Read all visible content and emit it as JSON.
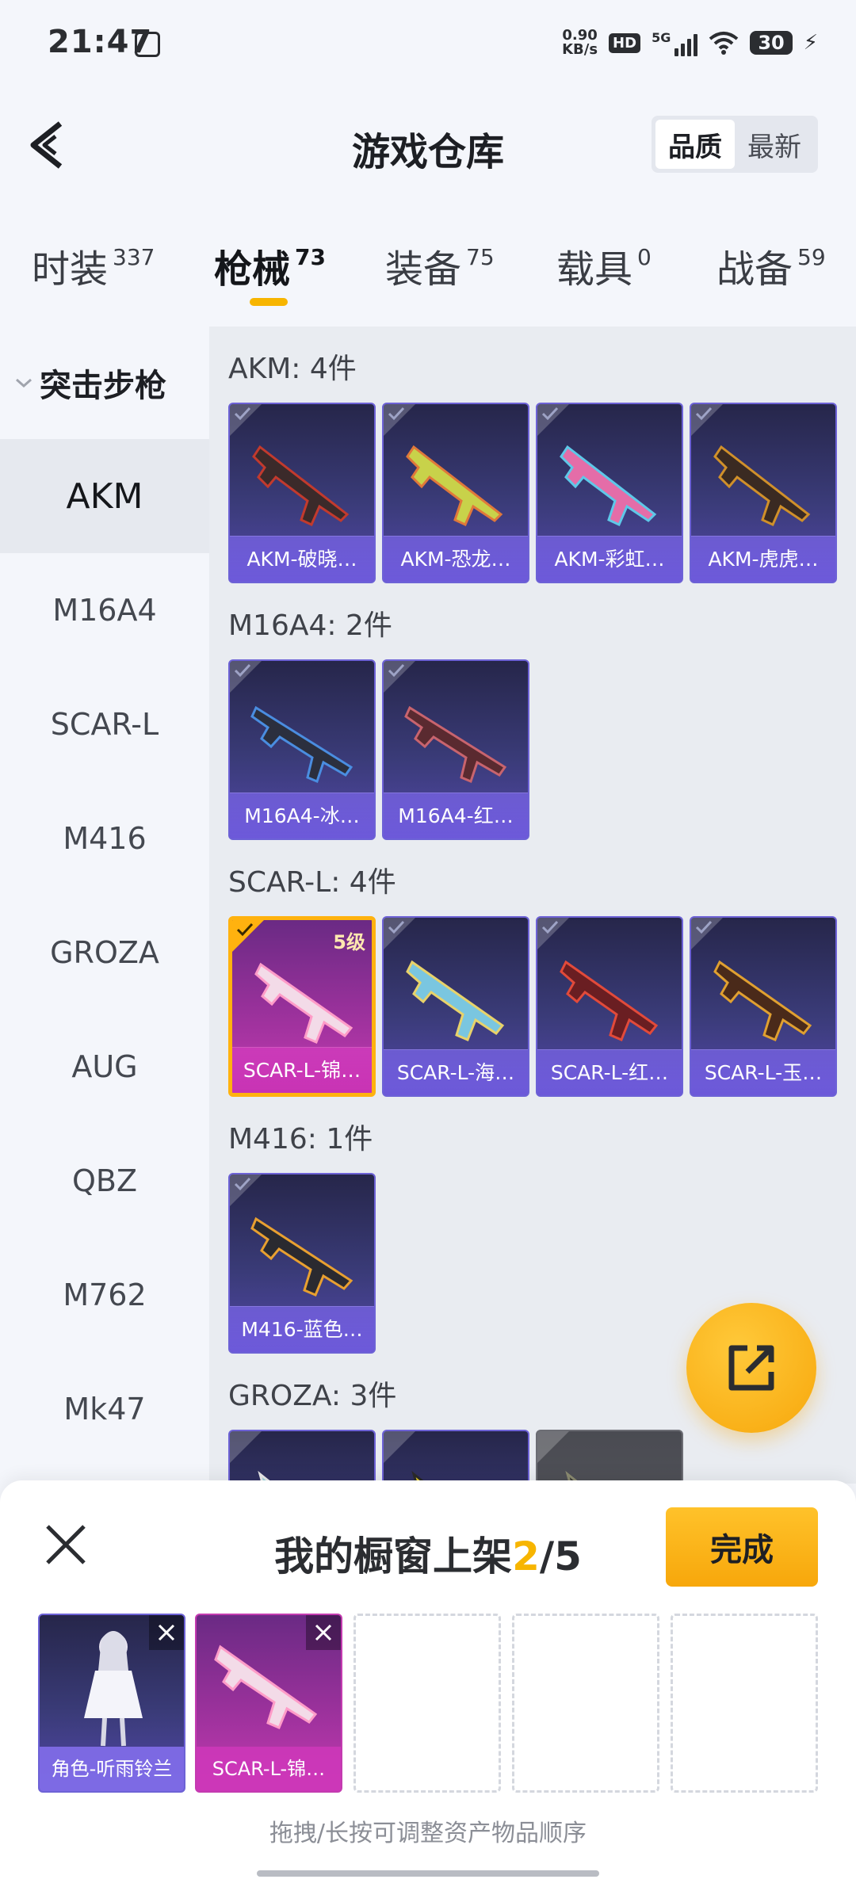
{
  "status_bar": {
    "time": "21:47",
    "net_speed_value": "0.90",
    "net_speed_unit": "KB/s",
    "hd": "HD",
    "network": "5G",
    "battery": "30"
  },
  "header": {
    "title": "游戏仓库",
    "sort_quality": "品质",
    "sort_latest": "最新"
  },
  "tabs": [
    {
      "label": "时装",
      "count": "337"
    },
    {
      "label": "枪械",
      "count": "73"
    },
    {
      "label": "装备",
      "count": "75"
    },
    {
      "label": "载具",
      "count": "0"
    },
    {
      "label": "战备",
      "count": "59"
    }
  ],
  "sidebar": {
    "group": "突击步枪",
    "items": [
      "AKM",
      "M16A4",
      "SCAR-L",
      "M416",
      "GROZA",
      "AUG",
      "QBZ",
      "M762",
      "Mk47"
    ]
  },
  "sections": [
    {
      "label": "AKM: 4件",
      "items": [
        "AKM-破晓…",
        "AKM-恐龙…",
        "AKM-彩虹…",
        "AKM-虎虎…"
      ]
    },
    {
      "label": "M16A4: 2件",
      "items": [
        "M16A4-冰…",
        "M16A4-红…"
      ]
    },
    {
      "label": "SCAR-L: 4件",
      "items": [
        "SCAR-L-锦…",
        "SCAR-L-海…",
        "SCAR-L-红…",
        "SCAR-L-玉…"
      ],
      "selected_level": "5级"
    },
    {
      "label": "M416: 1件",
      "items": [
        "M416-蓝色…"
      ]
    },
    {
      "label": "GROZA: 3件",
      "items": [
        "",
        "",
        ""
      ]
    }
  ],
  "sheet": {
    "title_prefix": "我的橱窗上架",
    "count_current": "2",
    "count_total": "/5",
    "done": "完成",
    "slots": [
      "角色-听雨铃兰",
      "SCAR-L-锦…"
    ],
    "hint": "拖拽/长按可调整资产物品顺序"
  },
  "colors": {
    "accent": "#f7b500",
    "card_purple": "#5247a8",
    "card_selected": "#c43bb0"
  }
}
